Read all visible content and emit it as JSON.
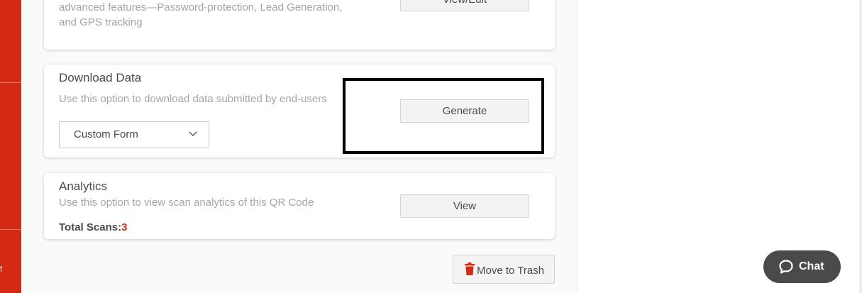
{
  "sidebar": {
    "fragment_text": "f"
  },
  "cards": {
    "advanced": {
      "desc_line1": "advanced features—Password-protection, Lead Generation,",
      "desc_line2": "and GPS tracking",
      "button_label": "View/Edit"
    },
    "download": {
      "title": "Download Data",
      "desc": "Use this option to download data submitted by end-users",
      "select_value": "Custom Form",
      "button_label": "Generate"
    },
    "analytics": {
      "title": "Analytics",
      "desc": "Use this option to view scan analytics of this QR Code",
      "total_label": "Total Scans:",
      "total_value": "3",
      "button_label": "View"
    }
  },
  "trash": {
    "label": "Move to Trash",
    "icon": "trash-icon"
  },
  "chat": {
    "label": "Chat",
    "icon": "chat-bubble-icon"
  },
  "colors": {
    "brand_red": "#d42a14",
    "chat_bg": "#4a4a4a"
  }
}
